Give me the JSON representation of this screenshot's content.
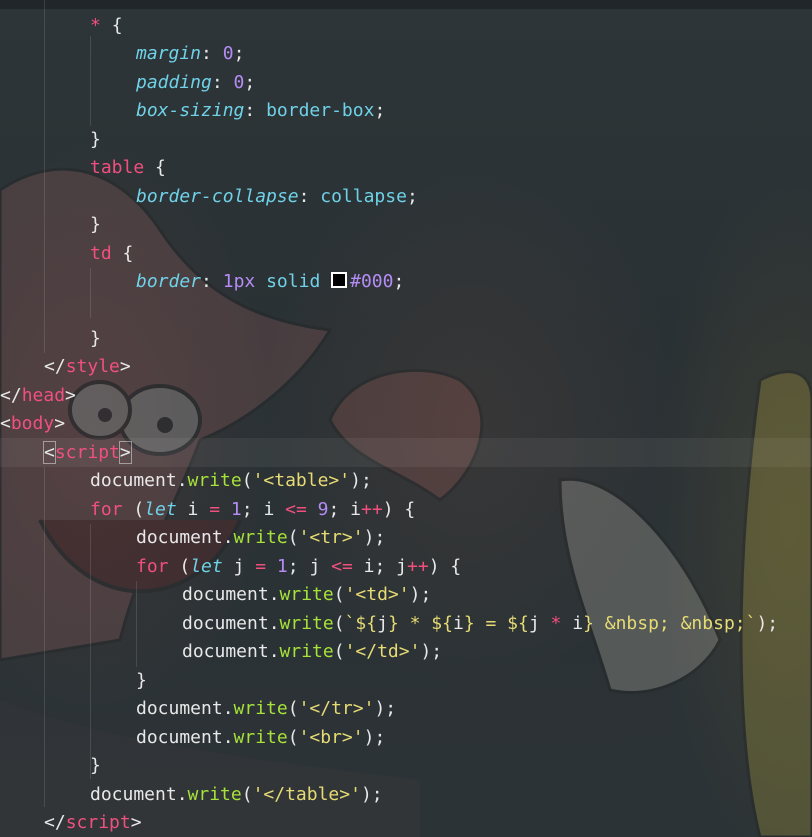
{
  "editor": {
    "colors": {
      "selector": "#f1507f",
      "property": "#6fd2e8",
      "number": "#b48cf5",
      "function": "#a6e23a",
      "string": "#e6db74",
      "text": "#e8e8e8"
    },
    "swatch_color": "#000000"
  },
  "code": {
    "l1": {
      "sel": "*",
      "brace": "{"
    },
    "l2": {
      "prop": "margin",
      "colon": ": ",
      "num": "0",
      "semi": ";"
    },
    "l3": {
      "prop": "padding",
      "colon": ": ",
      "num": "0",
      "semi": ";"
    },
    "l4": {
      "prop": "box-sizing",
      "colon": ": ",
      "val": "border-box",
      "semi": ";"
    },
    "l5": {
      "brace": "}"
    },
    "l6": {
      "sel": "table",
      "brace": "{"
    },
    "l7": {
      "prop": "border-collapse",
      "colon": ": ",
      "val": "collapse",
      "semi": ";"
    },
    "l8": {
      "brace": "}"
    },
    "l9": {
      "sel": "td",
      "brace": "{"
    },
    "l10": {
      "prop": "border",
      "colon": ": ",
      "num": "1",
      "unit": "px",
      "val": "solid",
      "color": "#000",
      "semi": ";"
    },
    "l12": {
      "brace": "}"
    },
    "l13": {
      "open": "</",
      "tag": "style",
      "close": ">"
    },
    "l14": {
      "open": "</",
      "tag": "head",
      "close": ">"
    },
    "l15": {
      "open": "<",
      "tag": "body",
      "close": ">"
    },
    "l16": {
      "open": "<",
      "tag": "script",
      "close": ">"
    },
    "l17": {
      "obj": "document",
      "dot": ".",
      "fn": "write",
      "p1": "(",
      "str": "'<table>'",
      "p2": ");"
    },
    "l18": {
      "kw": "for",
      "p1": " (",
      "let": "let",
      "v": " i ",
      "eq": "=",
      "sp": " ",
      "n1": "1",
      "s1": "; i ",
      "le": "<=",
      "sp2": " ",
      "n2": "9",
      "s2": "; i",
      "inc": "++",
      "end": ") {"
    },
    "l19": {
      "obj": "document",
      "dot": ".",
      "fn": "write",
      "p1": "(",
      "str": "'<tr>'",
      "p2": ");"
    },
    "l20": {
      "kw": "for",
      "p1": " (",
      "let": "let",
      "v": " j ",
      "eq": "=",
      "sp": " ",
      "n1": "1",
      "s1": "; j ",
      "le": "<=",
      "s2": " i; j",
      "inc": "++",
      "end": ") {"
    },
    "l21": {
      "obj": "document",
      "dot": ".",
      "fn": "write",
      "p1": "(",
      "str": "'<td>'",
      "p2": ");"
    },
    "l22": {
      "obj": "document",
      "dot": ".",
      "fn": "write",
      "p1": "(",
      "t1": "`${",
      "j": "j",
      "t2": "} * ${",
      "i": "i",
      "t3": "} = ${",
      "expr1": "j ",
      "mul": "*",
      "expr2": " i",
      "t4": "} &nbsp; &nbsp;`",
      "p2": ");"
    },
    "l23": {
      "obj": "document",
      "dot": ".",
      "fn": "write",
      "p1": "(",
      "str": "'</td>'",
      "p2": ");"
    },
    "l24": {
      "brace": "}"
    },
    "l25": {
      "obj": "document",
      "dot": ".",
      "fn": "write",
      "p1": "(",
      "str": "'</tr>'",
      "p2": ");"
    },
    "l26": {
      "obj": "document",
      "dot": ".",
      "fn": "write",
      "p1": "(",
      "str": "'<br>'",
      "p2": ");"
    },
    "l27": {
      "brace": "}"
    },
    "l28": {
      "obj": "document",
      "dot": ".",
      "fn": "write",
      "p1": "(",
      "str": "'</table>'",
      "p2": ");"
    },
    "l29": {
      "open": "</",
      "tag": "script",
      "close": ">"
    }
  }
}
